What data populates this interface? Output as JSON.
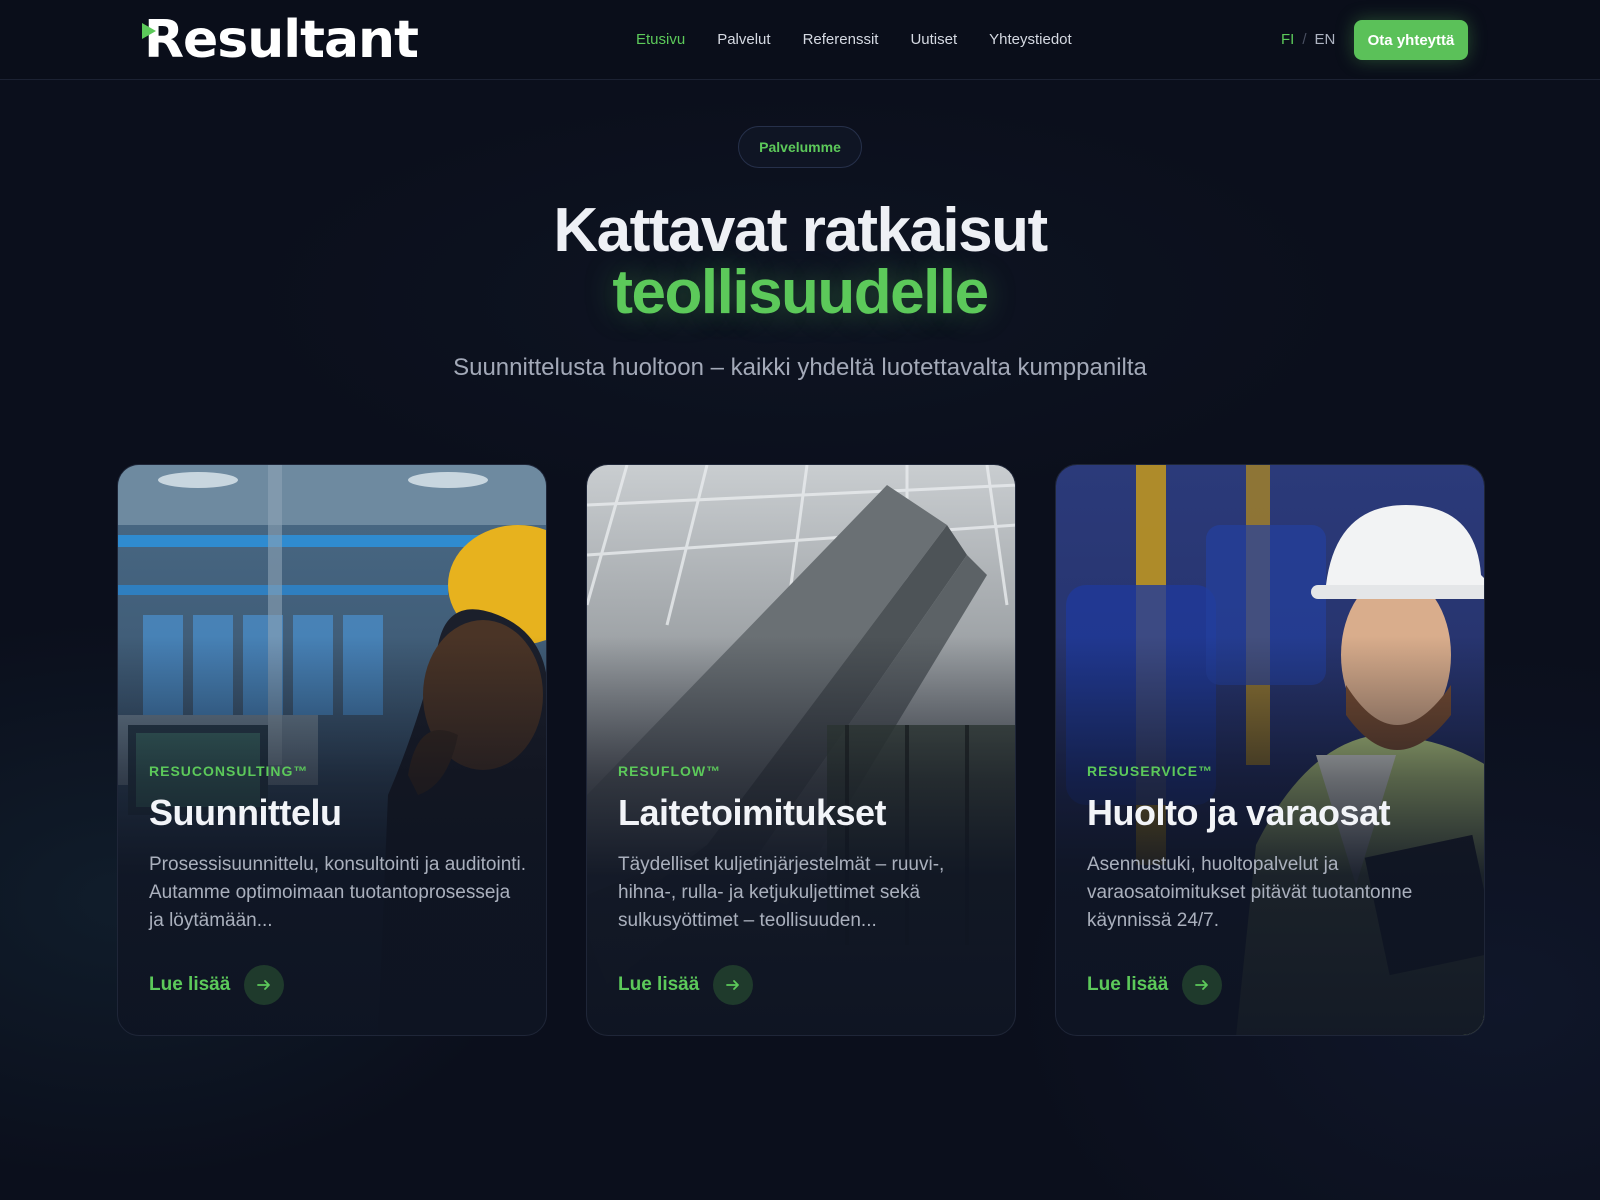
{
  "header": {
    "logo_text": "Resultant",
    "nav": [
      {
        "label": "Etusivu",
        "active": true
      },
      {
        "label": "Palvelut",
        "active": false
      },
      {
        "label": "Referenssit",
        "active": false
      },
      {
        "label": "Uutiset",
        "active": false
      },
      {
        "label": "Yhteystiedot",
        "active": false
      }
    ],
    "lang": {
      "fi": "FI",
      "sep": "/",
      "en": "EN"
    },
    "cta_label": "Ota yhteyttä"
  },
  "hero": {
    "pill": "Palvelumme",
    "title_line1": "Kattavat ratkaisut",
    "title_line2": "teollisuudelle",
    "subtitle": "Suunnittelusta huoltoon – kaikki yhdeltä luotettavalta kumppanilta"
  },
  "cards": [
    {
      "tag": "RESUCONSULTING™",
      "title": "Suunnittelu",
      "description": "Prosessisuunnittelu, konsultointi ja auditointi. Autamme optimoimaan tuotantoprosesseja ja löytämään...",
      "link": "Lue lisää",
      "image": "engineer-at-control-panel"
    },
    {
      "tag": "RESUFLOW™",
      "title": "Laitetoimitukset",
      "description": "Täydelliset kuljetinjärjestelmät – ruuvi-, hihna-, rulla- ja ketjukuljettimet sekä sulkusyöttimet – teollisuuden...",
      "link": "Lue lisää",
      "image": "industrial-conveyor"
    },
    {
      "tag": "RESUSERVICE™",
      "title": "Huolto ja varaosat",
      "description": "Asennustuki, huoltopalvelut ja varaosatoimitukset pitävät tuotantonne käynnissä 24/7.",
      "link": "Lue lisää",
      "image": "worker-in-hard-hat"
    }
  ],
  "colors": {
    "background": "#0b0f1c",
    "accent": "#5cc95a",
    "text": "#eef0f5"
  }
}
